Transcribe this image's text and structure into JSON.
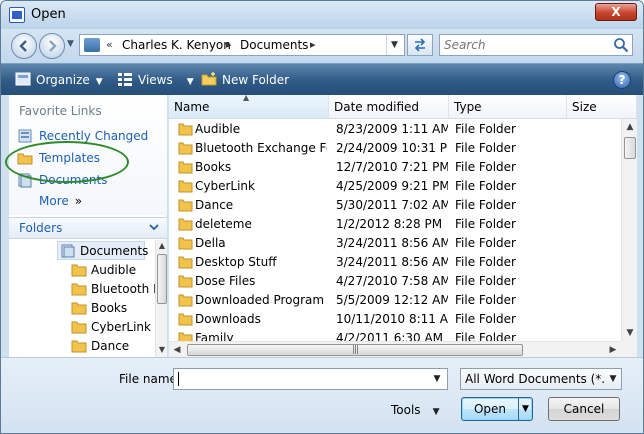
{
  "window": {
    "title": "Open",
    "close_label": "X"
  },
  "address_bar": {
    "overflow": "«",
    "crumbs": [
      "Charles K. Kenyon",
      "Documents"
    ],
    "search_placeholder": "Search"
  },
  "toolbar": {
    "organize": "Organize",
    "views": "Views",
    "new_folder": "New Folder",
    "help": "?"
  },
  "nav_pane": {
    "favorites_header": "Favorite Links",
    "favorites": [
      {
        "label": "Recently Changed",
        "icon": "recent-folder-icon"
      },
      {
        "label": "Templates",
        "icon": "folder-icon"
      },
      {
        "label": "Documents",
        "icon": "documents-icon"
      }
    ],
    "more": "More",
    "more_chevron": "»",
    "folders_header": "Folders",
    "tree": [
      {
        "label": "Documents",
        "selected": true
      },
      {
        "label": "Audible"
      },
      {
        "label": "Bluetooth E"
      },
      {
        "label": "Books"
      },
      {
        "label": "CyberLink"
      },
      {
        "label": "Dance"
      }
    ]
  },
  "file_list": {
    "columns": [
      "Name",
      "Date modified",
      "Type",
      "Size"
    ],
    "rows": [
      {
        "name": "Audible",
        "date": "8/23/2009 1:11 AM",
        "type": "File Folder"
      },
      {
        "name": "Bluetooth Exchange Fo...",
        "date": "2/24/2009 10:31 PM",
        "type": "File Folder"
      },
      {
        "name": "Books",
        "date": "12/7/2010 7:21 PM",
        "type": "File Folder"
      },
      {
        "name": "CyberLink",
        "date": "4/25/2009 9:21 PM",
        "type": "File Folder"
      },
      {
        "name": "Dance",
        "date": "5/30/2011 7:02 AM",
        "type": "File Folder"
      },
      {
        "name": "deleteme",
        "date": "1/2/2012 8:28 PM",
        "type": "File Folder"
      },
      {
        "name": "Della",
        "date": "3/24/2011 8:56 AM",
        "type": "File Folder"
      },
      {
        "name": "Desktop Stuff",
        "date": "3/24/2011 8:56 AM",
        "type": "File Folder"
      },
      {
        "name": "Dose Files",
        "date": "4/27/2010 7:58 AM",
        "type": "File Folder"
      },
      {
        "name": "Downloaded Program ...",
        "date": "5/5/2009 12:12 AM",
        "type": "File Folder"
      },
      {
        "name": "Downloads",
        "date": "10/11/2010 8:11 AM",
        "type": "File Folder"
      },
      {
        "name": "Family",
        "date": "4/2/2011 6:30 AM",
        "type": "File Folder"
      }
    ]
  },
  "bottom": {
    "file_name_label": "File name:",
    "file_name_value": "",
    "file_type": "All Word Documents (*.docx;*",
    "tools": "Tools",
    "open": "Open",
    "cancel": "Cancel"
  },
  "colors": {
    "link_blue": "#1d5fb4",
    "toolbar_blue": "#2f5a86",
    "annotation_green": "#2f8a2a",
    "folder_yellow": "#f2c34a"
  }
}
